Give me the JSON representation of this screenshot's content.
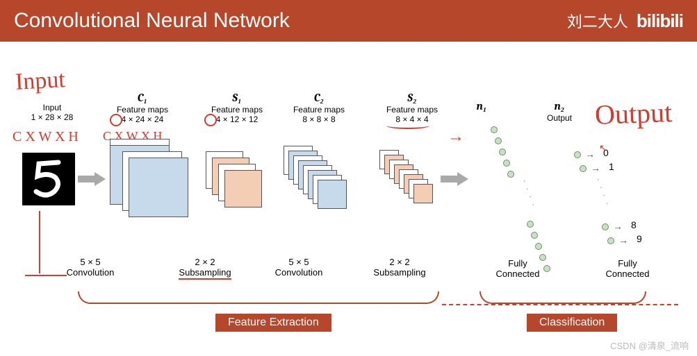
{
  "title": "Convolutional Neural Network",
  "credit": "刘二大人",
  "platform": "bilibili",
  "watermark": "CSDN @清泉_流响",
  "annotations": {
    "input_hand": "Input",
    "cwh": "C X W X H",
    "cwh2": "C X W X H",
    "output_hand": "Output"
  },
  "layers": {
    "input": {
      "name": "Input",
      "dims": "1 × 28 × 28"
    },
    "c1": {
      "name": "C₁",
      "sub": "Feature maps",
      "dims": "4 × 24 × 24"
    },
    "s1": {
      "name": "S₁",
      "sub": "Feature maps",
      "dims": "4 × 12 × 12"
    },
    "c2": {
      "name": "C₂",
      "sub": "Feature maps",
      "dims": "8 × 8 × 8"
    },
    "s2": {
      "name": "S₂",
      "sub": "Feature maps",
      "dims": "8 × 4 × 4"
    },
    "n1": {
      "name": "n₁"
    },
    "n2": {
      "name": "n₂",
      "sub": "Output"
    }
  },
  "ops": {
    "conv1": {
      "size": "5 × 5",
      "name": "Convolution"
    },
    "sub1": {
      "size": "2 × 2",
      "name": "Subsampling"
    },
    "conv2": {
      "size": "5 × 5",
      "name": "Convolution"
    },
    "sub2": {
      "size": "2 × 2",
      "name": "Subsampling"
    },
    "fc1": {
      "name": "Fully\nConnected"
    },
    "fc2": {
      "name": "Fully\nConnected"
    }
  },
  "sections": {
    "feat": "Feature Extraction",
    "cls": "Classification"
  },
  "outputs": [
    "0",
    "1",
    "8",
    "9"
  ]
}
